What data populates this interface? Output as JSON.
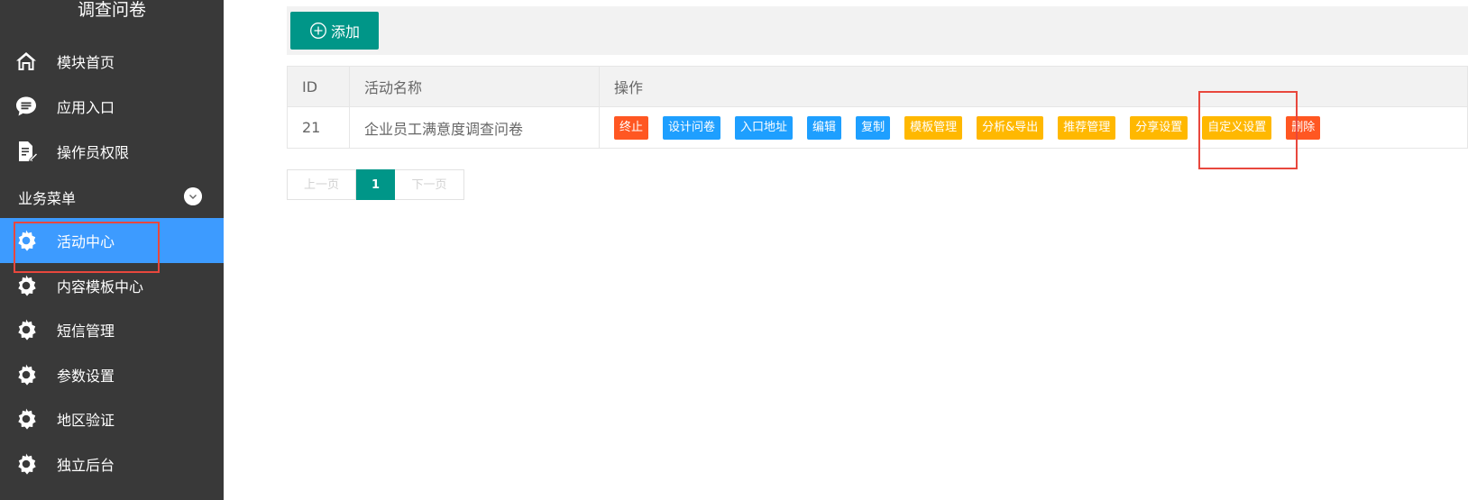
{
  "sidebar": {
    "title": "调查问卷",
    "top_items": [
      {
        "label": "模块首页",
        "icon": "home-icon"
      },
      {
        "label": "应用入口",
        "icon": "chat-bubble-icon"
      },
      {
        "label": "操作员权限",
        "icon": "document-edit-icon"
      }
    ],
    "group_label": "业务菜单",
    "group_items": [
      {
        "label": "活动中心",
        "icon": "gear-icon",
        "active": true
      },
      {
        "label": "内容模板中心",
        "icon": "gear-icon"
      },
      {
        "label": "短信管理",
        "icon": "gear-icon"
      },
      {
        "label": "参数设置",
        "icon": "gear-icon"
      },
      {
        "label": "地区验证",
        "icon": "gear-icon"
      },
      {
        "label": "独立后台",
        "icon": "gear-icon"
      }
    ]
  },
  "toolbar": {
    "add_label": "添加"
  },
  "table": {
    "headers": [
      "ID",
      "活动名称",
      "操作"
    ],
    "rows": [
      {
        "id": "21",
        "name": "企业员工满意度调查问卷"
      }
    ],
    "actions": [
      {
        "label": "终止",
        "color": "#ff5722"
      },
      {
        "label": "设计问卷",
        "color": "#1e9fff"
      },
      {
        "label": "入口地址",
        "color": "#1e9fff"
      },
      {
        "label": "编辑",
        "color": "#1e9fff"
      },
      {
        "label": "复制",
        "color": "#1e9fff"
      },
      {
        "label": "模板管理",
        "color": "#ffb800"
      },
      {
        "label": "分析&导出",
        "color": "#ffb800"
      },
      {
        "label": "推荐管理",
        "color": "#ffb800"
      },
      {
        "label": "分享设置",
        "color": "#ffb800"
      },
      {
        "label": "自定义设置",
        "color": "#ffb800"
      },
      {
        "label": "删除",
        "color": "#ff5722"
      }
    ]
  },
  "pager": {
    "prev": "上一页",
    "current": "1",
    "next": "下一页"
  },
  "colors": {
    "sidebar": "#393939",
    "active": "#3d9bff",
    "primary": "#009688",
    "highlight": "#e8473d"
  }
}
